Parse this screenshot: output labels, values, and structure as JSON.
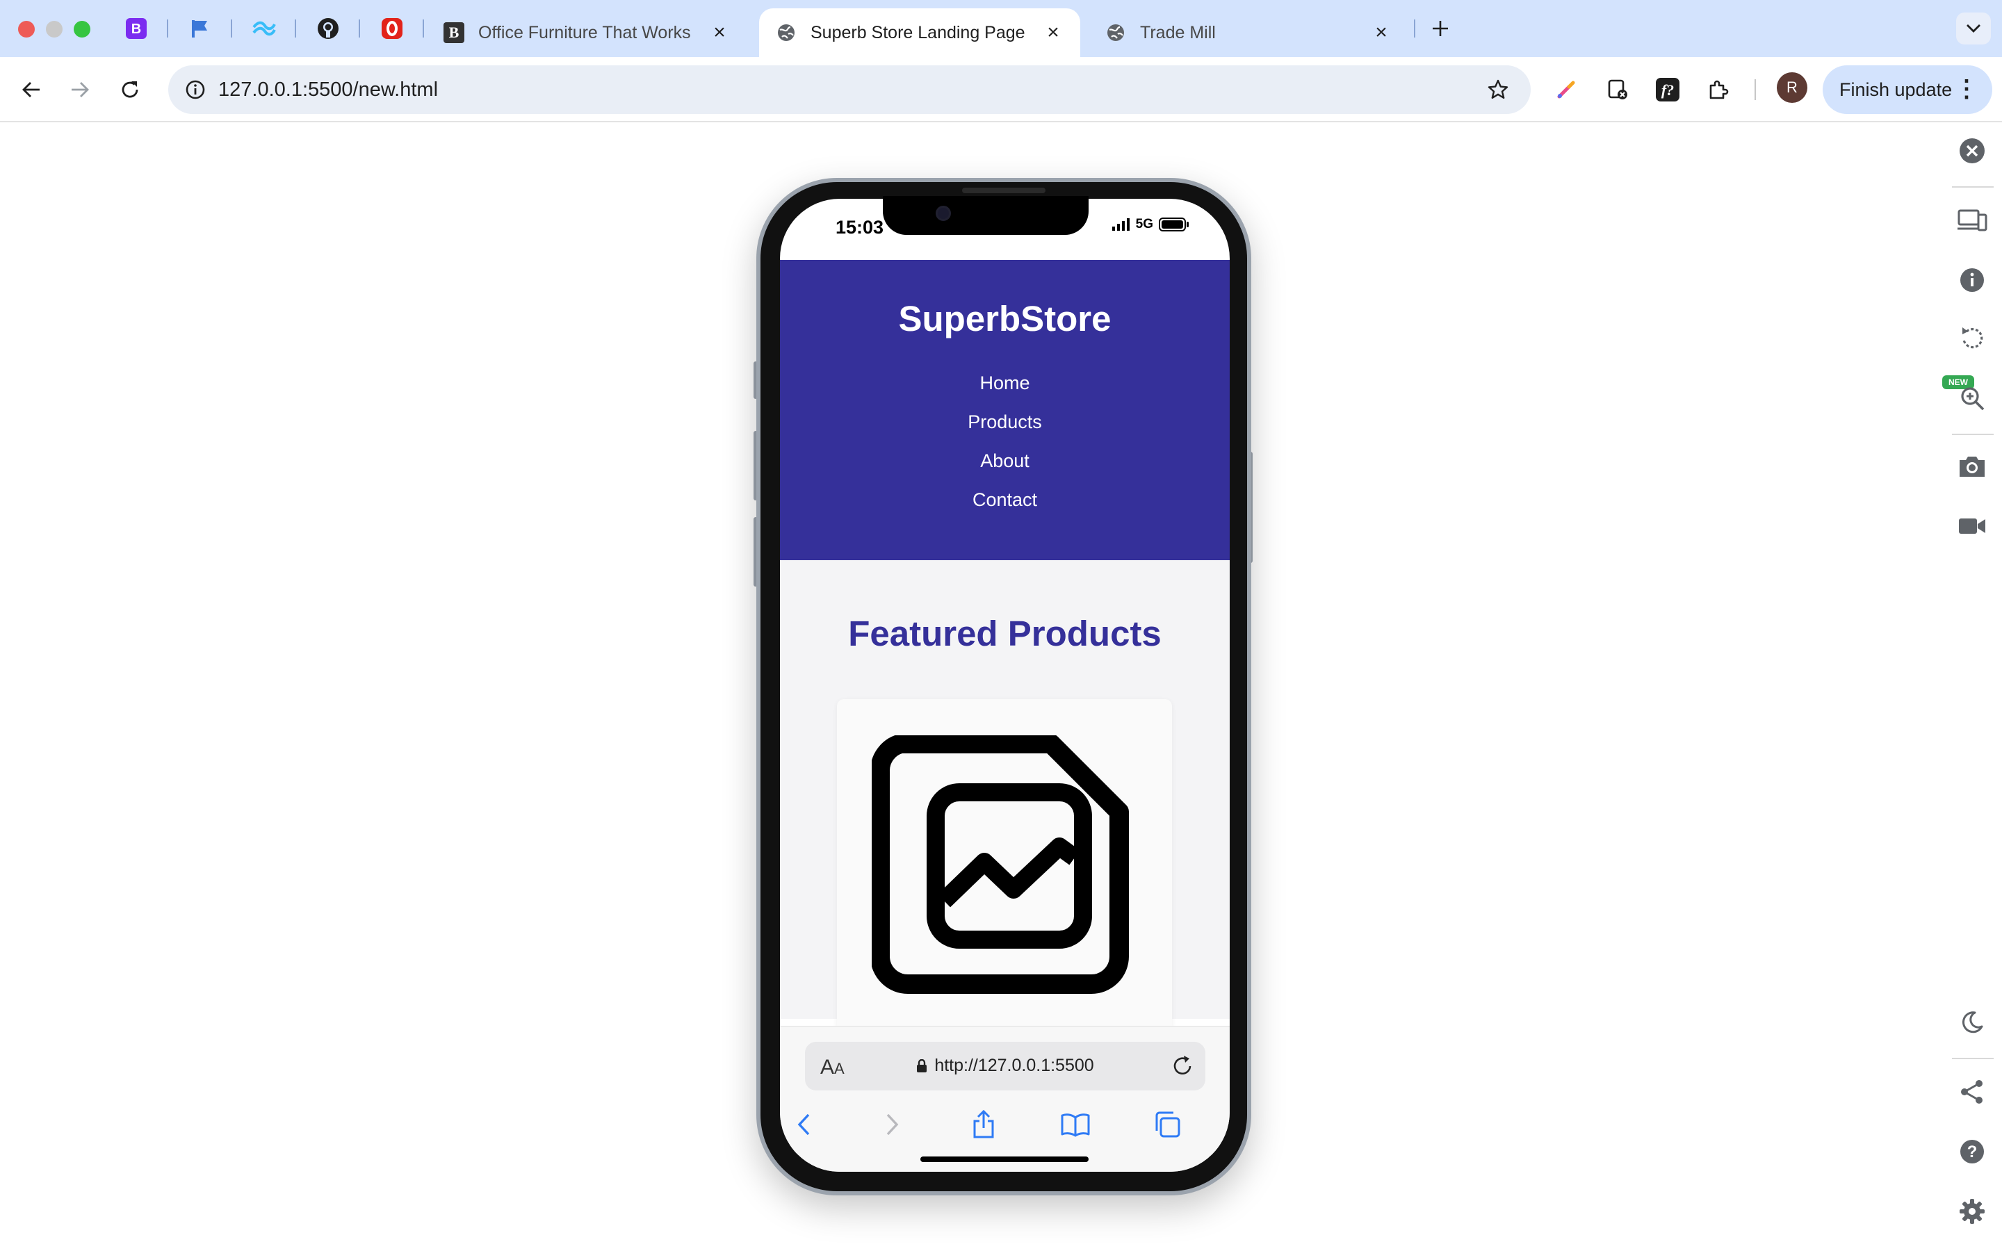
{
  "browser": {
    "pinned_tabs": [
      "bootstrap-tab-icon",
      "flag-tab-icon",
      "tailwind-tab-icon",
      "github-tab-icon",
      "opera-tab-icon"
    ],
    "tabs": [
      {
        "title": "Office Furniture That Works |",
        "favicon": "bootstrap-b-icon",
        "active": false
      },
      {
        "title": "Superb Store Landing Page",
        "favicon": "globe-icon",
        "active": true
      },
      {
        "title": "Trade Mill",
        "favicon": "globe-icon",
        "active": false
      }
    ],
    "new_tab_icon": "plus-icon",
    "tab_list_icon": "chevron-down-icon",
    "address": "127.0.0.1:5500/new.html",
    "profile_initial": "R",
    "update_button": "Finish update",
    "colors": {
      "tabstrip": "#d3e3fd",
      "omnibox": "#e9eef6",
      "active_tab": "#ffffff"
    }
  },
  "side_panel": {
    "icons": [
      "close-icon",
      "devices-icon",
      "info-icon",
      "rotate-icon",
      "zoom-icon",
      "camera-icon",
      "video-icon",
      "moon-icon",
      "share-icon",
      "help-icon",
      "settings-icon"
    ],
    "new_badge": "NEW"
  },
  "phone": {
    "status": {
      "time": "15:03",
      "network": "5G"
    },
    "site": {
      "brand": "SuperbStore",
      "nav": [
        "Home",
        "Products",
        "About",
        "Contact"
      ],
      "section_title": "Featured Products",
      "product_image_icon": "image-placeholder-icon"
    },
    "safari": {
      "text_size_big": "A",
      "text_size_small": "A",
      "url": "http://127.0.0.1:5500"
    },
    "colors": {
      "header": "#35309a",
      "heading": "#35309a",
      "main_bg": "#f4f4f6",
      "link_blue": "#2f7bf5"
    }
  }
}
